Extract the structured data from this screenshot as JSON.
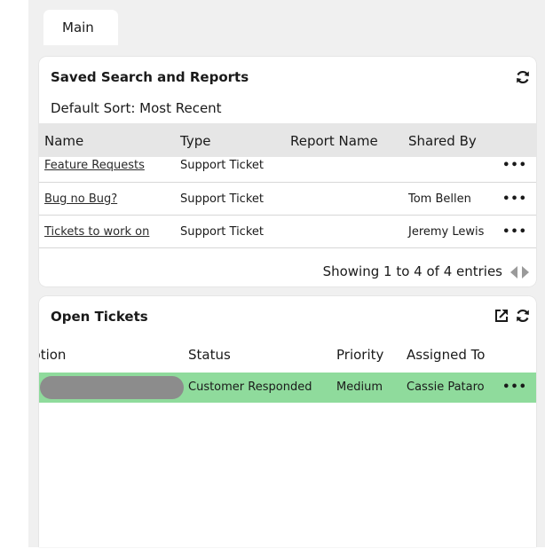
{
  "tabs": [
    {
      "label": "Main"
    }
  ],
  "saved_search": {
    "title": "Saved Search and Reports",
    "sort_label": "Default Sort: Most Recent",
    "columns": [
      "Name",
      "Type",
      "Report Name",
      "Shared By"
    ],
    "rows": [
      {
        "name": "Feature Requests",
        "type": "Support Ticket",
        "report_name": "",
        "shared_by": "",
        "actions": "•••"
      },
      {
        "name": "Bug no Bug?",
        "type": "Support Ticket",
        "report_name": "",
        "shared_by": "Tom Bellen",
        "actions": "•••"
      },
      {
        "name": "Tickets to work on",
        "type": "Support Ticket",
        "report_name": "",
        "shared_by": "Jeremy Lewis",
        "actions": "•••"
      }
    ],
    "pagination": "Showing 1 to 4 of 4 entries"
  },
  "open_tickets": {
    "title": "Open Tickets",
    "columns": [
      "iption",
      "Status",
      "Priority",
      "Assigned To"
    ],
    "rows": [
      {
        "description": "",
        "status": "Customer Responded",
        "priority": "Medium",
        "assigned_to": "Cassie Pataro",
        "actions": "•••",
        "row_color": "#8fdb9c"
      }
    ]
  },
  "icons": {
    "refresh": "refresh-icon",
    "external_link": "external-link-icon",
    "prev": "chevron-left-icon",
    "next": "chevron-right-icon"
  }
}
